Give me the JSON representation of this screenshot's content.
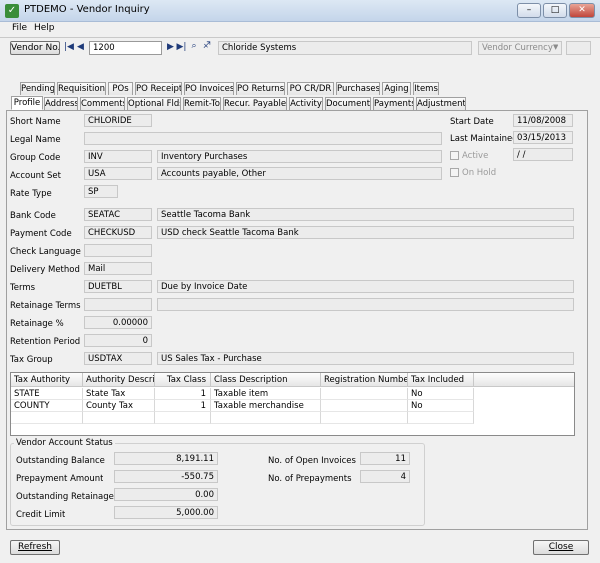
{
  "window": {
    "title": "PTDEMO - Vendor Inquiry",
    "min": "–",
    "max": "□",
    "close": "✕"
  },
  "menu": {
    "file": "File",
    "help": "Help"
  },
  "toolbar": {
    "vendor_button": "Vendor No.",
    "vendor_no": "1200",
    "vendor_name": "Chloride Systems",
    "currency_placeholder": "Vendor Currency"
  },
  "tabs_row1": [
    "Pending",
    "Requisitions",
    "POs",
    "PO Receipts",
    "PO Invoices",
    "PO Returns",
    "PO CR/DR",
    "Purchases",
    "Aging",
    "Items"
  ],
  "tabs_row2": [
    "Profile",
    "Address",
    "Comments",
    "Optional Flds.",
    "Remit-To",
    "Recur. Payables",
    "Activity",
    "Documents",
    "Payments",
    "Adjustments"
  ],
  "profile": {
    "short_name": {
      "label": "Short Name",
      "value": "CHLORIDE"
    },
    "legal_name": {
      "label": "Legal Name",
      "value": ""
    },
    "group_code": {
      "label": "Group Code",
      "value": "INV",
      "desc": "Inventory Purchases"
    },
    "account_set": {
      "label": "Account Set",
      "value": "USA",
      "desc": "Accounts payable, Other"
    },
    "rate_type": {
      "label": "Rate Type",
      "value": "SP"
    },
    "bank_code": {
      "label": "Bank Code",
      "value": "SEATAC",
      "desc": "Seattle Tacoma Bank"
    },
    "payment_code": {
      "label": "Payment Code",
      "value": "CHECKUSD",
      "desc": "USD check Seattle Tacoma Bank"
    },
    "check_language": {
      "label": "Check Language",
      "value": ""
    },
    "delivery_method": {
      "label": "Delivery Method",
      "value": "Mail"
    },
    "terms": {
      "label": "Terms",
      "value": "DUETBL",
      "desc": "Due by Invoice Date"
    },
    "retainage_terms": {
      "label": "Retainage Terms",
      "value": "",
      "desc": ""
    },
    "retainage_pct": {
      "label": "Retainage %",
      "value": "0.00000"
    },
    "retention_period": {
      "label": "Retention Period",
      "value": "0"
    },
    "tax_group": {
      "label": "Tax Group",
      "value": "USDTAX",
      "desc": "US Sales Tax - Purchase"
    },
    "start_date": {
      "label": "Start Date",
      "value": "11/08/2008"
    },
    "last_maintained": {
      "label": "Last Maintained",
      "value": "03/15/2013"
    },
    "active": {
      "label": "Active",
      "value": " /  /"
    },
    "on_hold": {
      "label": "On Hold"
    }
  },
  "tax_grid": {
    "headers": [
      "Tax Authority",
      "Authority Descri...",
      "Tax Class",
      "Class Description",
      "Registration Number",
      "Tax Included"
    ],
    "rows": [
      [
        "STATE",
        "State Tax",
        "1",
        "Taxable item",
        "",
        "No"
      ],
      [
        "COUNTY",
        "County Tax",
        "1",
        "Taxable merchandise",
        "",
        "No"
      ]
    ]
  },
  "status": {
    "title": "Vendor Account Status",
    "outstanding_balance": {
      "label": "Outstanding Balance",
      "value": "8,191.11"
    },
    "prepayment_amount": {
      "label": "Prepayment Amount",
      "value": "-550.75"
    },
    "outstanding_retainage": {
      "label": "Outstanding Retainage",
      "value": "0.00"
    },
    "credit_limit": {
      "label": "Credit Limit",
      "value": "5,000.00"
    },
    "open_invoices": {
      "label": "No. of Open Invoices",
      "value": "11"
    },
    "prepayments": {
      "label": "No. of Prepayments",
      "value": "4"
    }
  },
  "buttons": {
    "refresh": "Refresh",
    "close": "Close"
  }
}
